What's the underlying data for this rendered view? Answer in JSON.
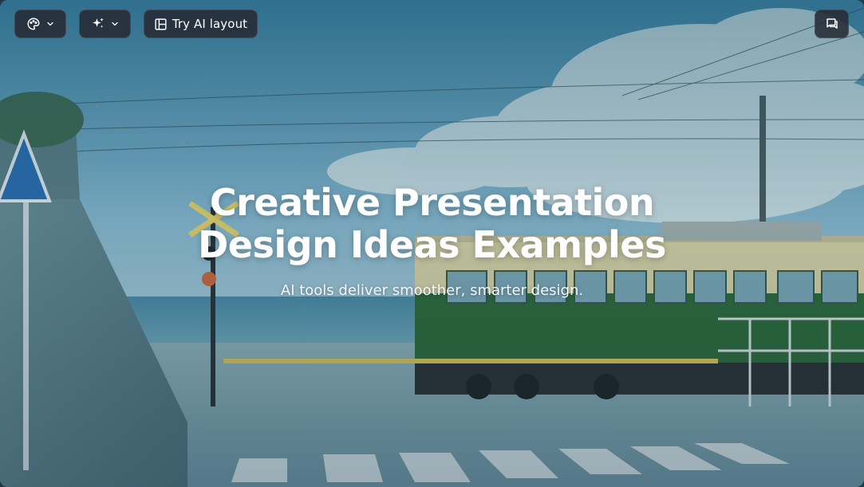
{
  "toolbar": {
    "theme_icon": "palette-icon",
    "ai_icon": "sparkle-icon",
    "layout_label": "Try AI layout",
    "layout_icon": "layout-icon",
    "comment_icon": "comment-icon"
  },
  "slide": {
    "title_line1": "Creative Presentation",
    "title_line2": "Design Ideas Examples",
    "subtitle": "AI tools deliver smoother, smarter design."
  },
  "colors": {
    "button_bg": "#262a34",
    "title_text": "#ffffff",
    "tram_green": "#2f6b3a",
    "tram_cream": "#e6dfb0",
    "sky": "#6fa9c8",
    "sea": "#3d7f9a"
  }
}
